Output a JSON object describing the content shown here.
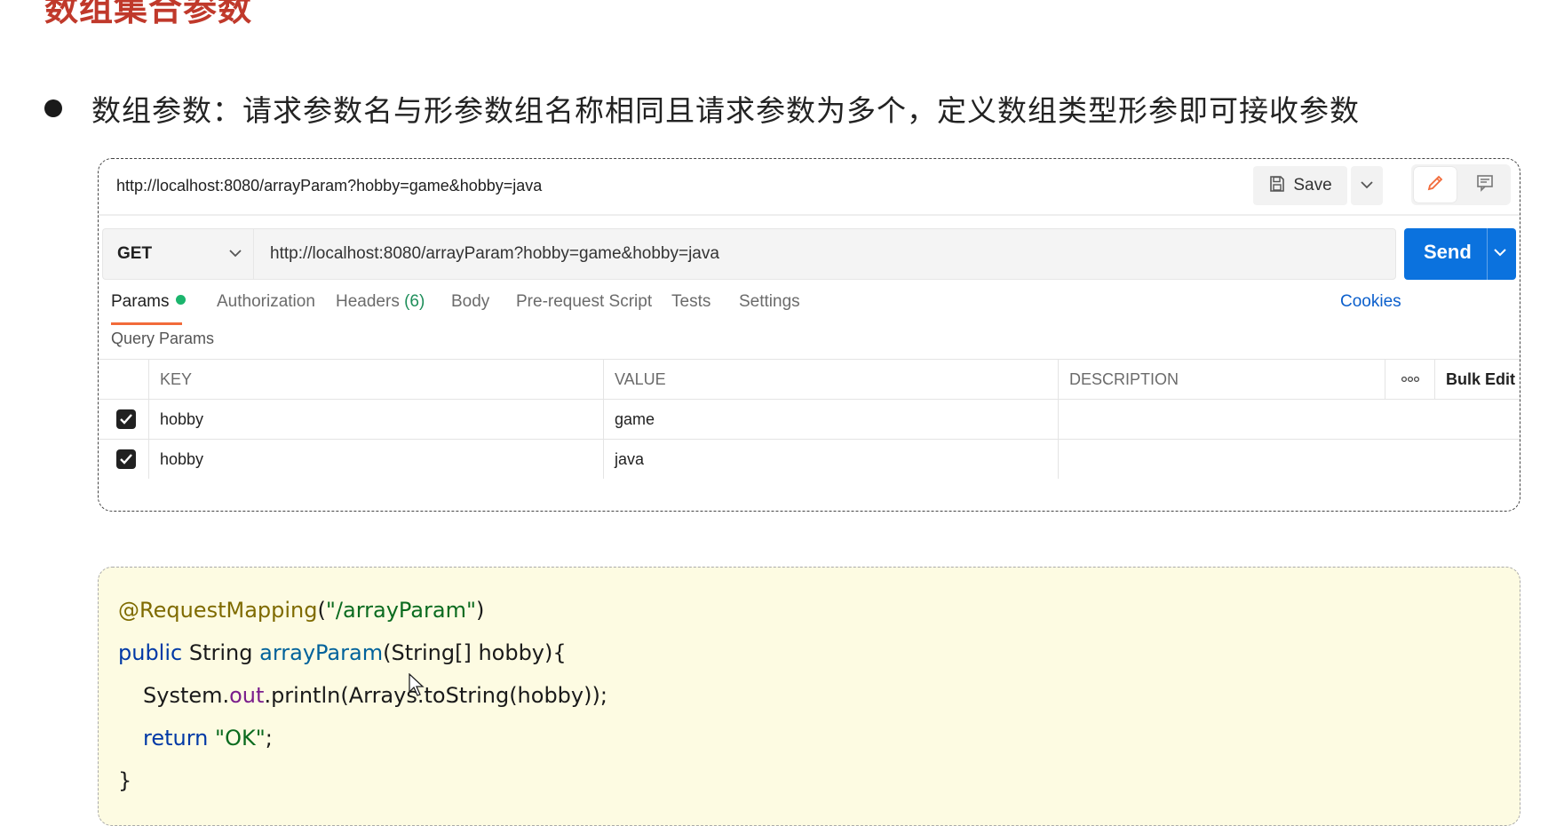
{
  "slide": {
    "title": "数组集合参数",
    "bullet": "数组参数：请求参数名与形参数组名称相同且请求参数为多个，定义数组类型形参即可接收参数"
  },
  "postman": {
    "request_title": "http://localhost:8080/arrayParam?hobby=game&hobby=java",
    "save_label": "Save",
    "method": "GET",
    "url": "http://localhost:8080/arrayParam?hobby=game&hobby=java",
    "send_label": "Send",
    "tabs": [
      {
        "label": "Params"
      },
      {
        "label": "Authorization"
      },
      {
        "label": "Headers",
        "count": "(6)"
      },
      {
        "label": "Body"
      },
      {
        "label": "Pre-request Script"
      },
      {
        "label": "Tests"
      },
      {
        "label": "Settings"
      }
    ],
    "cookies_label": "Cookies",
    "query_params_label": "Query Params",
    "table": {
      "headers": {
        "key": "KEY",
        "value": "VALUE",
        "description": "DESCRIPTION",
        "bulk_edit": "Bulk Edit"
      },
      "rows": [
        {
          "key": "hobby",
          "value": "game",
          "description": "",
          "checked": true
        },
        {
          "key": "hobby",
          "value": "java",
          "description": "",
          "checked": true
        }
      ]
    },
    "colors": {
      "send": "#0b72de",
      "active_tab_underline": "#f26b3a",
      "params_dot": "#1bb56d",
      "cookies": "#0b5fcc"
    }
  },
  "code": {
    "line1": {
      "annotation": "@RequestMapping",
      "open": "(",
      "string": "\"/arrayParam\"",
      "close": ")"
    },
    "line2": {
      "kw": "public",
      "type": " String ",
      "method": "arrayParam",
      "rest": "(String[] hobby){"
    },
    "line3": {
      "pre": "System.",
      "field": "out",
      "rest": ".println(Arrays.toString(hobby));"
    },
    "line4": {
      "kw": "return",
      "sp": " ",
      "string": "\"OK\"",
      "end": ";"
    },
    "line5": {
      "brace": "}"
    }
  },
  "icons": [
    "save-icon",
    "chevron-down-icon",
    "pencil-icon",
    "comment-icon",
    "more-icon",
    "checkmark-icon",
    "mouse-cursor-icon"
  ]
}
